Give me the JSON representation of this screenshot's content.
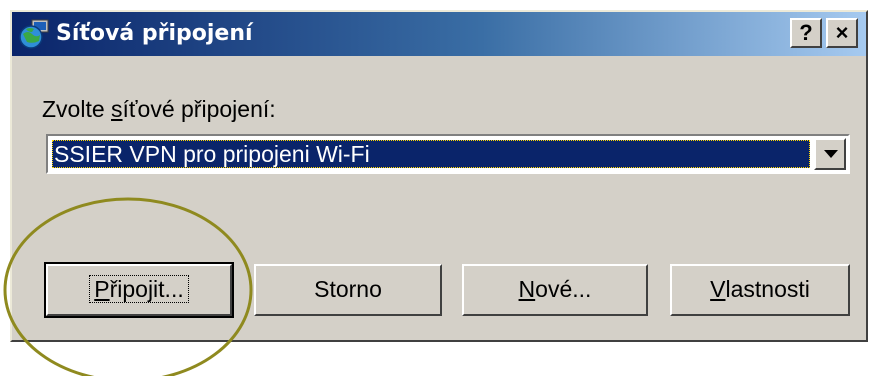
{
  "window": {
    "title": "Síťová připojení",
    "help_label": "?",
    "close_label": "×"
  },
  "form": {
    "label_prefix": "Zvolte ",
    "label_access": "s",
    "label_rest": "íťové připojení:",
    "selected_connection": "SSIER VPN pro pripojeni Wi-Fi"
  },
  "buttons": {
    "connect_access": "P",
    "connect_rest": "řipojit...",
    "cancel": "Storno",
    "new_access": "N",
    "new_rest": "ové...",
    "properties_access": "V",
    "properties_rest": "lastnosti"
  },
  "icons": {
    "title": "network-globe-icon",
    "dropdown": "chevron-down-icon"
  },
  "colors": {
    "titlebar_start": "#0a246a",
    "titlebar_end": "#a6caf0",
    "dialog_face": "#d4d0c8",
    "selection": "#0a246a",
    "annotation_circle": "#8f8a1f"
  }
}
